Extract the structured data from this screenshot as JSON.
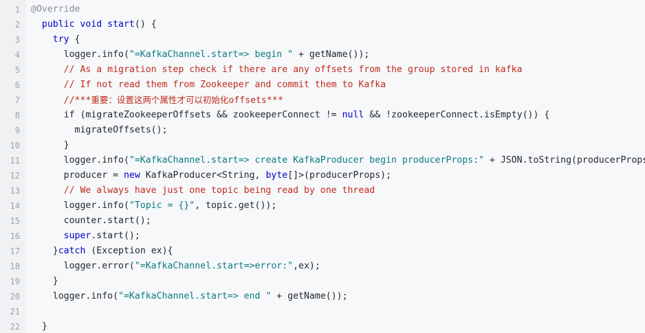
{
  "line_numbers": [
    "1",
    "2",
    "3",
    "4",
    "5",
    "6",
    "7",
    "8",
    "9",
    "10",
    "11",
    "12",
    "13",
    "14",
    "15",
    "16",
    "17",
    "18",
    "19",
    "20",
    "21",
    "22"
  ],
  "lines": [
    {
      "indent": "",
      "tokens": [
        {
          "t": "@Override",
          "c": "an"
        }
      ]
    },
    {
      "indent": "  ",
      "tokens": [
        {
          "t": "public void ",
          "c": "kw"
        },
        {
          "t": "start",
          "c": "fn"
        },
        {
          "t": "() {",
          "c": ""
        }
      ]
    },
    {
      "indent": "    ",
      "tokens": [
        {
          "t": "try",
          "c": "kw"
        },
        {
          "t": " {",
          "c": ""
        }
      ]
    },
    {
      "indent": "      ",
      "tokens": [
        {
          "t": "logger.info(",
          "c": ""
        },
        {
          "t": "\"=KafkaChannel.start=> begin \"",
          "c": "str"
        },
        {
          "t": " + getName());",
          "c": ""
        }
      ]
    },
    {
      "indent": "      ",
      "tokens": [
        {
          "t": "// As a migration step check if there are any offsets from the group stored in kafka",
          "c": "cm"
        }
      ]
    },
    {
      "indent": "      ",
      "tokens": [
        {
          "t": "// If not read them from Zookeeper and commit them to Kafka",
          "c": "cm"
        }
      ]
    },
    {
      "indent": "      ",
      "tokens": [
        {
          "t": "//***",
          "c": "cm"
        },
        {
          "t": "重要：设置这两个属性才可以初始化",
          "c": "cm cjk"
        },
        {
          "t": "offsets***",
          "c": "cm"
        }
      ]
    },
    {
      "indent": "      ",
      "tokens": [
        {
          "t": "if (migrateZookeeperOffsets && zookeeperConnect != ",
          "c": ""
        },
        {
          "t": "null",
          "c": "kw"
        },
        {
          "t": " && !zookeeperConnect.isEmpty()) {",
          "c": ""
        }
      ]
    },
    {
      "indent": "        ",
      "tokens": [
        {
          "t": "migrateOffsets();",
          "c": ""
        }
      ]
    },
    {
      "indent": "      ",
      "tokens": [
        {
          "t": "}",
          "c": ""
        }
      ]
    },
    {
      "indent": "      ",
      "tokens": [
        {
          "t": "logger.info(",
          "c": ""
        },
        {
          "t": "\"=KafkaChannel.start=> create KafkaProducer begin producerProps:\"",
          "c": "str"
        },
        {
          "t": " + JSON.toString(producerProps));",
          "c": ""
        }
      ]
    },
    {
      "indent": "      ",
      "tokens": [
        {
          "t": "producer = ",
          "c": ""
        },
        {
          "t": "new",
          "c": "kw"
        },
        {
          "t": " KafkaProducer<String, ",
          "c": ""
        },
        {
          "t": "byte",
          "c": "kw"
        },
        {
          "t": "[]>(producerProps);",
          "c": ""
        }
      ]
    },
    {
      "indent": "      ",
      "tokens": [
        {
          "t": "// We always have just one topic being read by one thread",
          "c": "cm"
        }
      ]
    },
    {
      "indent": "      ",
      "tokens": [
        {
          "t": "logger.info(",
          "c": ""
        },
        {
          "t": "\"Topic = {}\"",
          "c": "str"
        },
        {
          "t": ", topic.get());",
          "c": ""
        }
      ]
    },
    {
      "indent": "      ",
      "tokens": [
        {
          "t": "counter.start();",
          "c": ""
        }
      ]
    },
    {
      "indent": "      ",
      "tokens": [
        {
          "t": "super",
          "c": "kw"
        },
        {
          "t": ".start();",
          "c": ""
        }
      ]
    },
    {
      "indent": "    ",
      "tokens": [
        {
          "t": "}",
          "c": ""
        },
        {
          "t": "catch",
          "c": "kw"
        },
        {
          "t": " (Exception ex){",
          "c": ""
        }
      ]
    },
    {
      "indent": "      ",
      "tokens": [
        {
          "t": "logger.error(",
          "c": ""
        },
        {
          "t": "\"=KafkaChannel.start=>error:\"",
          "c": "str"
        },
        {
          "t": ",ex);",
          "c": ""
        }
      ]
    },
    {
      "indent": "    ",
      "tokens": [
        {
          "t": "}",
          "c": ""
        }
      ]
    },
    {
      "indent": "    ",
      "tokens": [
        {
          "t": "logger.info(",
          "c": ""
        },
        {
          "t": "\"=KafkaChannel.start=> end \"",
          "c": "str"
        },
        {
          "t": " + getName());",
          "c": ""
        }
      ]
    },
    {
      "indent": "",
      "tokens": []
    },
    {
      "indent": "  ",
      "tokens": [
        {
          "t": "}",
          "c": ""
        }
      ]
    }
  ],
  "colors": {
    "keyword": "#0000c6",
    "string": "#0b7a82",
    "comment": "#c12a1b",
    "annotation": "#8a8f96",
    "plain": "#24292e",
    "background": "#f6f8fa",
    "gutter": "#eff1f3"
  }
}
